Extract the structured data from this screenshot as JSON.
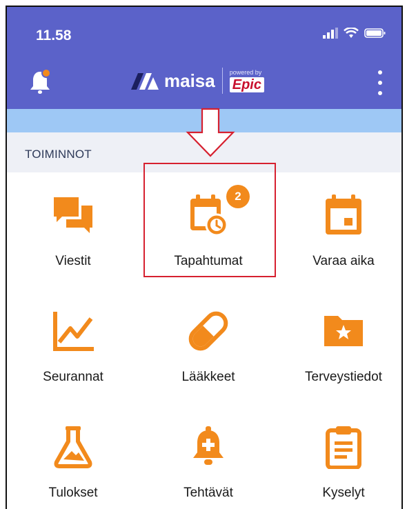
{
  "status_bar": {
    "time": "11.58",
    "icons": [
      "signal-icon",
      "wifi-icon",
      "battery-icon"
    ]
  },
  "header": {
    "notification_icon": "bell-icon",
    "brand_name": "maisa",
    "powered_by": "powered by",
    "partner": "Epic",
    "menu_icon": "kebab-menu-icon"
  },
  "section": {
    "title": "TOIMINNOT"
  },
  "tiles": [
    {
      "label": "Viestit",
      "icon": "chat-icon"
    },
    {
      "label": "Tapahtumat",
      "icon": "calendar-clock-icon",
      "badge": "2"
    },
    {
      "label": "Varaa aika",
      "icon": "calendar-icon"
    },
    {
      "label": "Seurannat",
      "icon": "line-chart-icon"
    },
    {
      "label": "Lääkkeet",
      "icon": "pill-icon"
    },
    {
      "label": "Terveystiedot",
      "icon": "folder-star-icon"
    },
    {
      "label": "Tulokset",
      "icon": "flask-icon"
    },
    {
      "label": "Tehtävät",
      "icon": "bell-plus-icon"
    },
    {
      "label": "Kyselyt",
      "icon": "clipboard-icon"
    }
  ],
  "colors": {
    "header": "#5b62c9",
    "light_band": "#9ec8f5",
    "section_bg": "#eef0f6",
    "accent": "#f28a1c",
    "highlight": "#d6202f"
  }
}
